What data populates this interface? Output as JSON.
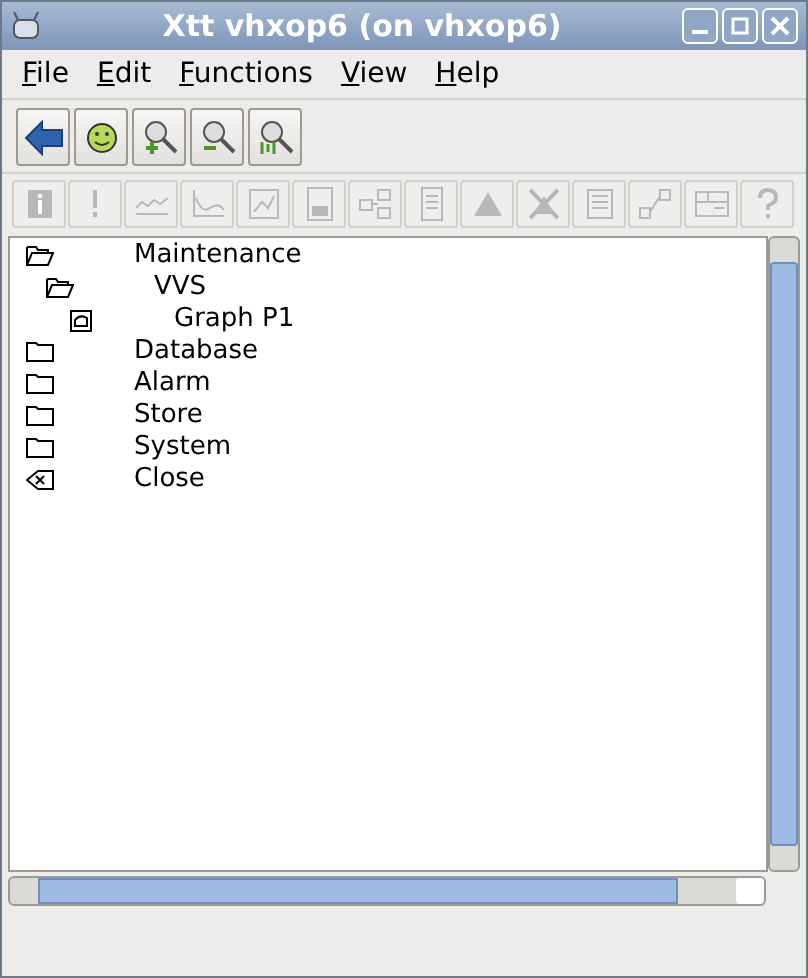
{
  "window": {
    "title": "Xtt vhxop6 (on vhxop6)"
  },
  "menu": [
    "File",
    "Edit",
    "Functions",
    "View",
    "Help"
  ],
  "toolbar": [
    {
      "kind": "back",
      "disabled": false
    },
    {
      "kind": "smiley",
      "disabled": false
    },
    {
      "kind": "zoom-in",
      "disabled": false
    },
    {
      "kind": "zoom-out",
      "disabled": false
    },
    {
      "kind": "zoom-reset",
      "disabled": false
    }
  ],
  "toolbar2": [
    {
      "kind": "info",
      "disabled": true
    },
    {
      "kind": "alert",
      "disabled": true
    },
    {
      "kind": "trend",
      "disabled": true
    },
    {
      "kind": "curve",
      "disabled": true
    },
    {
      "kind": "graph",
      "disabled": true
    },
    {
      "kind": "document",
      "disabled": true
    },
    {
      "kind": "hierarchy",
      "disabled": true
    },
    {
      "kind": "list",
      "disabled": true
    },
    {
      "kind": "triangle",
      "disabled": true
    },
    {
      "kind": "cross",
      "disabled": true
    },
    {
      "kind": "page",
      "disabled": true
    },
    {
      "kind": "crossref",
      "disabled": true
    },
    {
      "kind": "panel",
      "disabled": true
    },
    {
      "kind": "help",
      "disabled": true
    }
  ],
  "tree": [
    {
      "label": "Maintenance",
      "kind": "folder",
      "expanded": true,
      "children": [
        {
          "label": "VVS",
          "kind": "folder",
          "expanded": true,
          "children": [
            {
              "label": "Graph P1",
              "kind": "graph"
            }
          ]
        }
      ]
    },
    {
      "label": "Database",
      "kind": "folder",
      "expanded": false
    },
    {
      "label": "Alarm",
      "kind": "folder",
      "expanded": false
    },
    {
      "label": "Store",
      "kind": "folder",
      "expanded": false
    },
    {
      "label": "System",
      "kind": "folder",
      "expanded": false
    },
    {
      "label": "Close",
      "kind": "command"
    }
  ]
}
